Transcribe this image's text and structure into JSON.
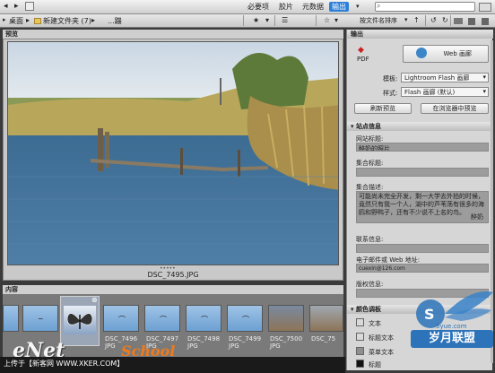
{
  "topbar": {
    "left_icons": [
      "back-arrow",
      "forward-arrow"
    ],
    "workspaces": [
      "必要项",
      "胶片",
      "元数据",
      "输出"
    ],
    "active_workspace": "输出",
    "search_placeholder": ""
  },
  "pathbar": {
    "crumbs": [
      "桌面",
      "新建文件夹 (7)",
      "...蹦"
    ],
    "sort_label": "按文件名排序"
  },
  "preview": {
    "title": "预览",
    "caption": "DSC_7495.JPG"
  },
  "content": {
    "title": "内容",
    "thumbnails": [
      {
        "label": ""
      },
      {
        "label": ""
      },
      {
        "label": ""
      },
      {
        "label": "DSC_7496\nJPG"
      },
      {
        "label": "DSC_7497\nJPG"
      },
      {
        "label": "DSC_7498\nJPG"
      },
      {
        "label": "DSC_7499\nJPG"
      },
      {
        "label": "DSC_7500\nJPG"
      },
      {
        "label": "DSC_75"
      }
    ]
  },
  "watermark": {
    "text": "上传于【新客网 WWW.XKER.COM】",
    "brand": "eNet",
    "brand2": "School",
    "logo_text": "岁月联盟",
    "logo_sub": "5yue.com"
  },
  "output_panel": {
    "title": "输出",
    "pdf_label": "PDF",
    "web_label": "Web 画廊",
    "template_label": "模板:",
    "template_value": "Lightroom Flash 画廊",
    "style_label": "样式:",
    "style_value": "Flash 画廊 (默认)",
    "refresh_button": "刷新预览",
    "browser_button": "在浏览器中预览",
    "site_info_title": "站点信息",
    "site_title_label": "网站标题:",
    "site_title_value": "醉奶的照片",
    "collection_title_label": "集合标题:",
    "collection_title_value": "",
    "collection_desc_label": "集合描述:",
    "collection_desc_value": "可能尚未完全开发，剩一大学去外拍的时候，竟然只有我一个人，湖中的芦苇荡有很多的海鸥和野鸭子，还有不少说不上名的鸟。",
    "collection_desc_tail": "醉奶",
    "contact_label": "联系信息:",
    "contact_value": "",
    "email_label": "电子邮件或 Web 地址:",
    "email_value": "cuexin@126.com",
    "copyright_label": "版权信息:",
    "copyright_value": "",
    "color_palette_title": "颜色调板",
    "colors": [
      {
        "name": "文本",
        "hex": "#d9d9d9"
      },
      {
        "name": "标题文本",
        "hex": "#d9d9d9"
      },
      {
        "name": "菜单文本",
        "hex": "#8f8f8f"
      },
      {
        "name": "标题",
        "hex": "#111111"
      }
    ]
  }
}
